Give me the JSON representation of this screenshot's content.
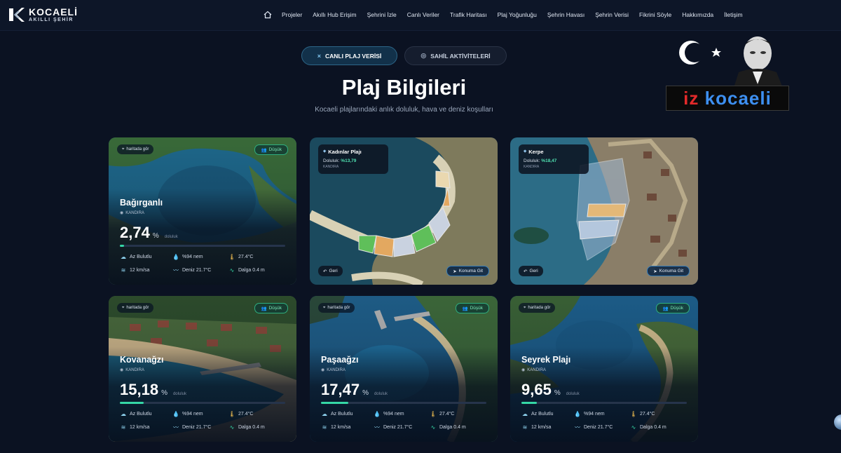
{
  "brand": {
    "line1": "KOCAELİ",
    "line2": "AKILLI ŞEHİR"
  },
  "nav": {
    "home_icon": "home-icon",
    "items": [
      "Projeler",
      "Akıllı Hub Erişim",
      "Şehrini İzle",
      "Canlı Veriler",
      "Trafik Haritası",
      "Plaj Yoğunluğu",
      "Şehrin Havası",
      "Şehrin Verisi",
      "Fikrini Söyle",
      "Hakkımızda",
      "İletişim"
    ]
  },
  "tabs": {
    "live": "CANLI PLAJ VERİSİ",
    "activities": "SAHİL AKTİVİTELERİ"
  },
  "hero": {
    "title": "Plaj Bilgileri",
    "subtitle": "Kocaeli plajlarındaki anlık doluluk, hava ve deniz koşulları"
  },
  "emblem": {
    "part1": "iz",
    "part2": "kocaeli"
  },
  "common": {
    "map_chip": "haritada gör",
    "status": "Düşük",
    "back": "Geri",
    "go": "Konuma Git",
    "weather": "Az Bulutlu",
    "humidity": "%94 nem",
    "temp": "27.4°C",
    "wind": "12 km/sa",
    "sea": "Deniz 21.7°C",
    "wave": "Dalga 0.4 m",
    "pct_sym": "%",
    "level": "doluluk"
  },
  "cards": [
    {
      "name": "Bağırganlı",
      "district": "KANDIRA",
      "occupancy": "2,74",
      "fill": 0.0274
    },
    {
      "name": "Kadınlar Plajı",
      "district": "KANDIRA",
      "occupancy_label": "Doluluk:",
      "occupancy": "%13,79"
    },
    {
      "name": "Kerpe",
      "district": "KANDIRA",
      "occupancy_label": "Doluluk:",
      "occupancy": "%18,47"
    },
    {
      "name": "Kovanağzı",
      "district": "KANDIRA",
      "occupancy": "15,18",
      "fill": 0.1518
    },
    {
      "name": "Paşaağzı",
      "district": "KANDIRA",
      "occupancy": "17,47",
      "fill": 0.1747
    },
    {
      "name": "Seyrek Plajı",
      "district": "KANDIRA",
      "occupancy": "9,65",
      "fill": 0.0965
    }
  ],
  "colors": {
    "accent": "#35d7a6",
    "bg": "#0b1222",
    "sea": "#1f5f8a"
  }
}
